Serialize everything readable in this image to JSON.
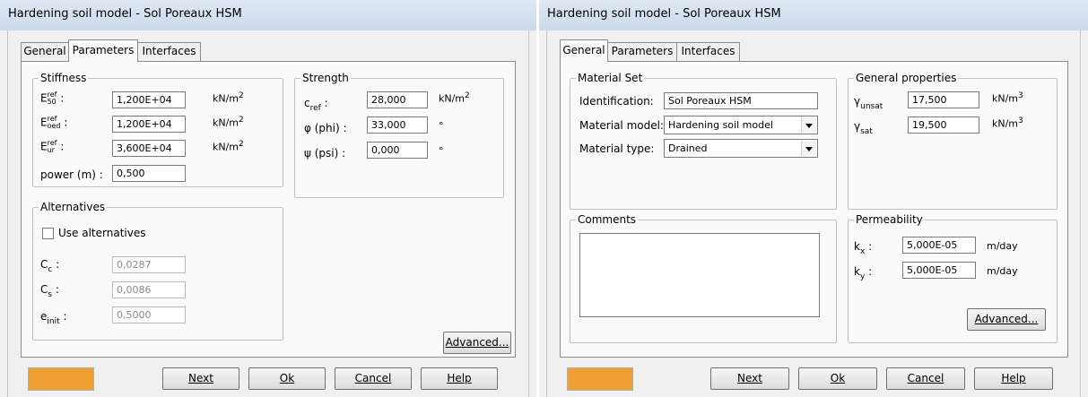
{
  "left": {
    "title": "Hardening soil model - Sol Poreaux HSM",
    "tabs": [
      "General",
      "Parameters",
      "Interfaces"
    ],
    "stiffness": {
      "label": "Stiffness",
      "e50": {
        "sym": "E",
        "sup": "ref",
        "sub": "50",
        "colon": ":",
        "value": "1,200E+04",
        "unit": "kN/m",
        "unit_sup": "2"
      },
      "eoed": {
        "sym": "E",
        "sup": "ref",
        "sub": "oed",
        "colon": ":",
        "value": "1,200E+04",
        "unit": "kN/m",
        "unit_sup": "2"
      },
      "eur": {
        "sym": "E",
        "sup": "ref",
        "sub": "ur",
        "colon": ":",
        "value": "3,600E+04",
        "unit": "kN/m",
        "unit_sup": "2"
      },
      "power": {
        "label": "power (m) :",
        "value": "0,500"
      }
    },
    "strength": {
      "label": "Strength",
      "cref": {
        "sym": "c",
        "sub": "ref",
        "colon": ":",
        "value": "28,000",
        "unit": "kN/m",
        "unit_sup": "2"
      },
      "phi": {
        "label": "φ (phi) :",
        "value": "33,000",
        "unit": "°"
      },
      "psi": {
        "label": "ψ (psi) :",
        "value": "0,000",
        "unit": "°"
      }
    },
    "alternatives": {
      "label": "Alternatives",
      "use_label": "Use alternatives",
      "use_checked": false,
      "cc": {
        "sym": "C",
        "sub": "c",
        "colon": ":",
        "value": "0,0287"
      },
      "cs": {
        "sym": "C",
        "sub": "s",
        "colon": ":",
        "value": "0,0086"
      },
      "einit": {
        "sym": "e",
        "sub": "init",
        "colon": ":",
        "value": "0,5000"
      }
    },
    "advanced_label": "Advanced...",
    "buttons": {
      "next": "Next",
      "ok": "Ok",
      "cancel": "Cancel",
      "help": "Help"
    },
    "swatch_color": "#f0a030"
  },
  "right": {
    "title": "Hardening soil model - Sol Poreaux HSM",
    "tabs": [
      "General",
      "Parameters",
      "Interfaces"
    ],
    "material_set": {
      "label": "Material Set",
      "identification_label": "Identification:",
      "identification_value": "Sol Poreaux HSM",
      "model_label": "Material model:",
      "model_value": "Hardening soil model",
      "type_label": "Material type:",
      "type_value": "Drained"
    },
    "general_properties": {
      "label": "General properties",
      "unsat": {
        "sym": "γ",
        "sub": "unsat",
        "value": "17,500",
        "unit": "kN/m",
        "unit_sup": "3"
      },
      "sat": {
        "sym": "γ",
        "sub": "sat",
        "value": "19,500",
        "unit": "kN/m",
        "unit_sup": "3"
      }
    },
    "comments": {
      "label": "Comments",
      "value": ""
    },
    "permeability": {
      "label": "Permeability",
      "kx": {
        "sym": "k",
        "sub": "x",
        "colon": ":",
        "value": "5,000E-05",
        "unit": "m/day"
      },
      "ky": {
        "sym": "k",
        "sub": "y",
        "colon": ":",
        "value": "5,000E-05",
        "unit": "m/day"
      }
    },
    "advanced_label": "Advanced...",
    "buttons": {
      "next": "Next",
      "ok": "Ok",
      "cancel": "Cancel",
      "help": "Help"
    },
    "swatch_color": "#f0a030"
  }
}
